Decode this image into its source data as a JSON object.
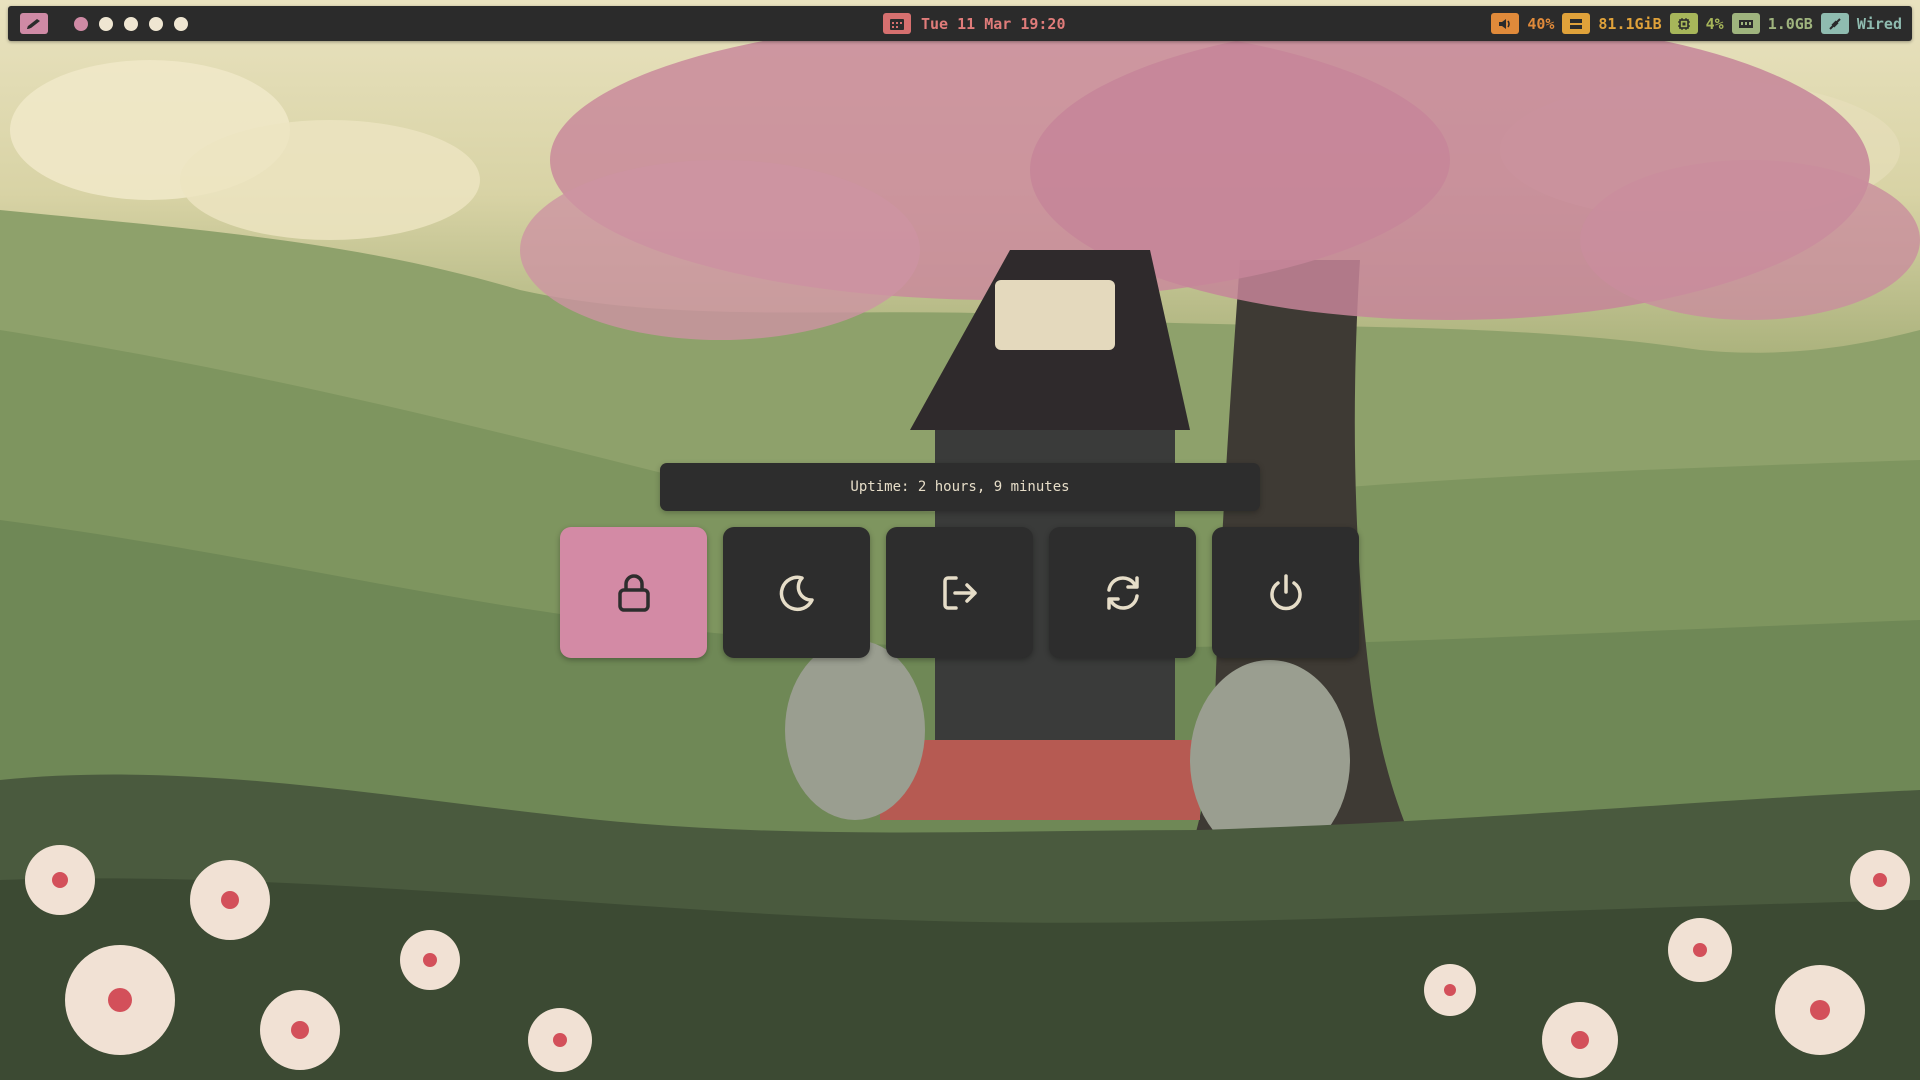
{
  "topbar": {
    "launcher_icon": "pencil-icon",
    "workspaces": [
      {
        "active": true
      },
      {
        "active": false
      },
      {
        "active": false
      },
      {
        "active": false
      },
      {
        "active": false
      }
    ],
    "clock": {
      "icon": "calendar-icon",
      "text": "Tue 11 Mar 19:20"
    },
    "status": {
      "volume": {
        "icon": "speaker-icon",
        "text": "40%",
        "color": "#e08a3a"
      },
      "disk": {
        "icon": "disk-icon",
        "text": "81.1GiB",
        "color": "#e0a23a"
      },
      "cpu": {
        "icon": "cpu-icon",
        "text": "4%",
        "color": "#a7b65a"
      },
      "memory": {
        "icon": "memory-icon",
        "text": "1.0GB",
        "color": "#9fb47e"
      },
      "network": {
        "icon": "ethernet-icon",
        "text": "Wired",
        "color": "#8fbcb0"
      }
    }
  },
  "power_menu": {
    "uptime": "Uptime: 2 hours, 9 minutes",
    "buttons": [
      {
        "icon": "lock-icon",
        "selected": true
      },
      {
        "icon": "moon-icon",
        "selected": false
      },
      {
        "icon": "logout-icon",
        "selected": false
      },
      {
        "icon": "reboot-icon",
        "selected": false
      },
      {
        "icon": "power-icon",
        "selected": false
      }
    ]
  },
  "colors": {
    "bar_bg": "#2b2b2b",
    "accent_pink": "#d38aa5",
    "clock_red": "#e07c7a",
    "panel_bg": "#2d2d2d",
    "text_light": "#e6ddc8"
  }
}
